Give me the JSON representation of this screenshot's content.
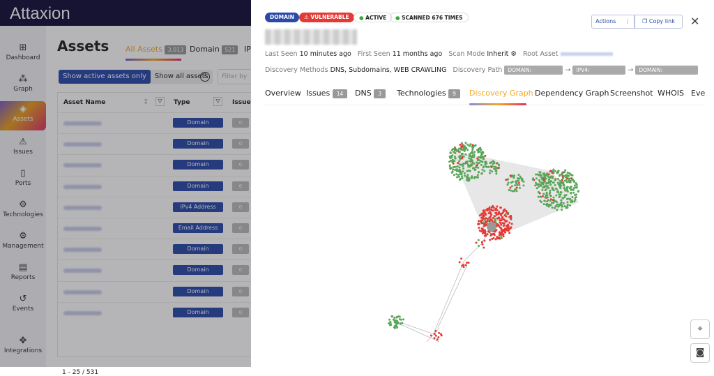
{
  "app": {
    "logo": "Attaxion"
  },
  "sidebar": {
    "items": [
      {
        "label": "Dashboard",
        "icon": "dashboard-icon",
        "g": "⊞"
      },
      {
        "label": "Graph",
        "icon": "graph-icon",
        "g": "⁂"
      },
      {
        "label": "Assets",
        "icon": "layers-icon",
        "g": "◈"
      },
      {
        "label": "Issues",
        "icon": "warning-icon",
        "g": "⚠"
      },
      {
        "label": "Ports",
        "icon": "port-icon",
        "g": "▯"
      },
      {
        "label": "Technologies",
        "icon": "chip-icon",
        "g": "⚙"
      },
      {
        "label": "Management",
        "icon": "gear-icon",
        "g": "⚙"
      },
      {
        "label": "Reports",
        "icon": "report-icon",
        "g": "▤"
      },
      {
        "label": "Events",
        "icon": "history-icon",
        "g": "↺"
      },
      {
        "label": "Integrations",
        "icon": "puzzle-icon",
        "g": "✥"
      }
    ],
    "active": "Assets"
  },
  "assets": {
    "title": "Assets",
    "tabs": [
      {
        "label": "All Assets",
        "count": "3,013"
      },
      {
        "label": "Domain",
        "count": "521"
      },
      {
        "label": "IP"
      }
    ],
    "toggle_active": "Show active assets only",
    "toggle_all": "Show all assets",
    "filter_placeholder": "Filter by",
    "columns": [
      "Asset Name",
      "Type",
      "Issues"
    ],
    "rows": [
      {
        "type": "Domain",
        "issues": "0"
      },
      {
        "type": "Domain",
        "issues": "0"
      },
      {
        "type": "Domain",
        "issues": "0"
      },
      {
        "type": "Domain",
        "issues": "0"
      },
      {
        "type": "IPv4 Address",
        "issues": "0"
      },
      {
        "type": "Email Address",
        "issues": "0"
      },
      {
        "type": "Domain",
        "issues": "0"
      },
      {
        "type": "Domain",
        "issues": "0"
      },
      {
        "type": "Domain",
        "issues": "0"
      },
      {
        "type": "Domain",
        "issues": "0"
      }
    ],
    "pagination": "1 - 25 / 531"
  },
  "detail": {
    "badges": {
      "type": "DOMAIN",
      "vulnerable": "VULNERABLE",
      "active": "ACTIVE",
      "scanned": "SCANNED 676 TIMES"
    },
    "actions": "Actions",
    "copy_link": "Copy link",
    "last_seen_label": "Last Seen",
    "last_seen": "10 minutes ago",
    "first_seen_label": "First Seen",
    "first_seen": "11 months ago",
    "scan_mode_label": "Scan Mode",
    "scan_mode": "Inherit",
    "root_asset_label": "Root Asset",
    "methods_label": "Discovery Methods",
    "methods": "DNS, Subdomains, WEB CRAWLING",
    "path_label": "Discovery Path",
    "path": [
      "DOMAIN:",
      "IPV4:",
      "DOMAIN:"
    ],
    "tabs": [
      {
        "label": "Overview"
      },
      {
        "label": "Issues",
        "count": "14"
      },
      {
        "label": "DNS",
        "count": "3"
      },
      {
        "label": "Technologies",
        "count": "9"
      },
      {
        "label": "Discovery Graph",
        "active": true
      },
      {
        "label": "Dependency Graph"
      },
      {
        "label": "Screenshot"
      },
      {
        "label": "WHOIS"
      },
      {
        "label": "Eve"
      }
    ]
  },
  "colors": {
    "accent": "#f5a623",
    "primary": "#2b4aa8",
    "vulnerable": "#e53935",
    "node_green": "#5aa65a",
    "node_red": "#e53935"
  }
}
